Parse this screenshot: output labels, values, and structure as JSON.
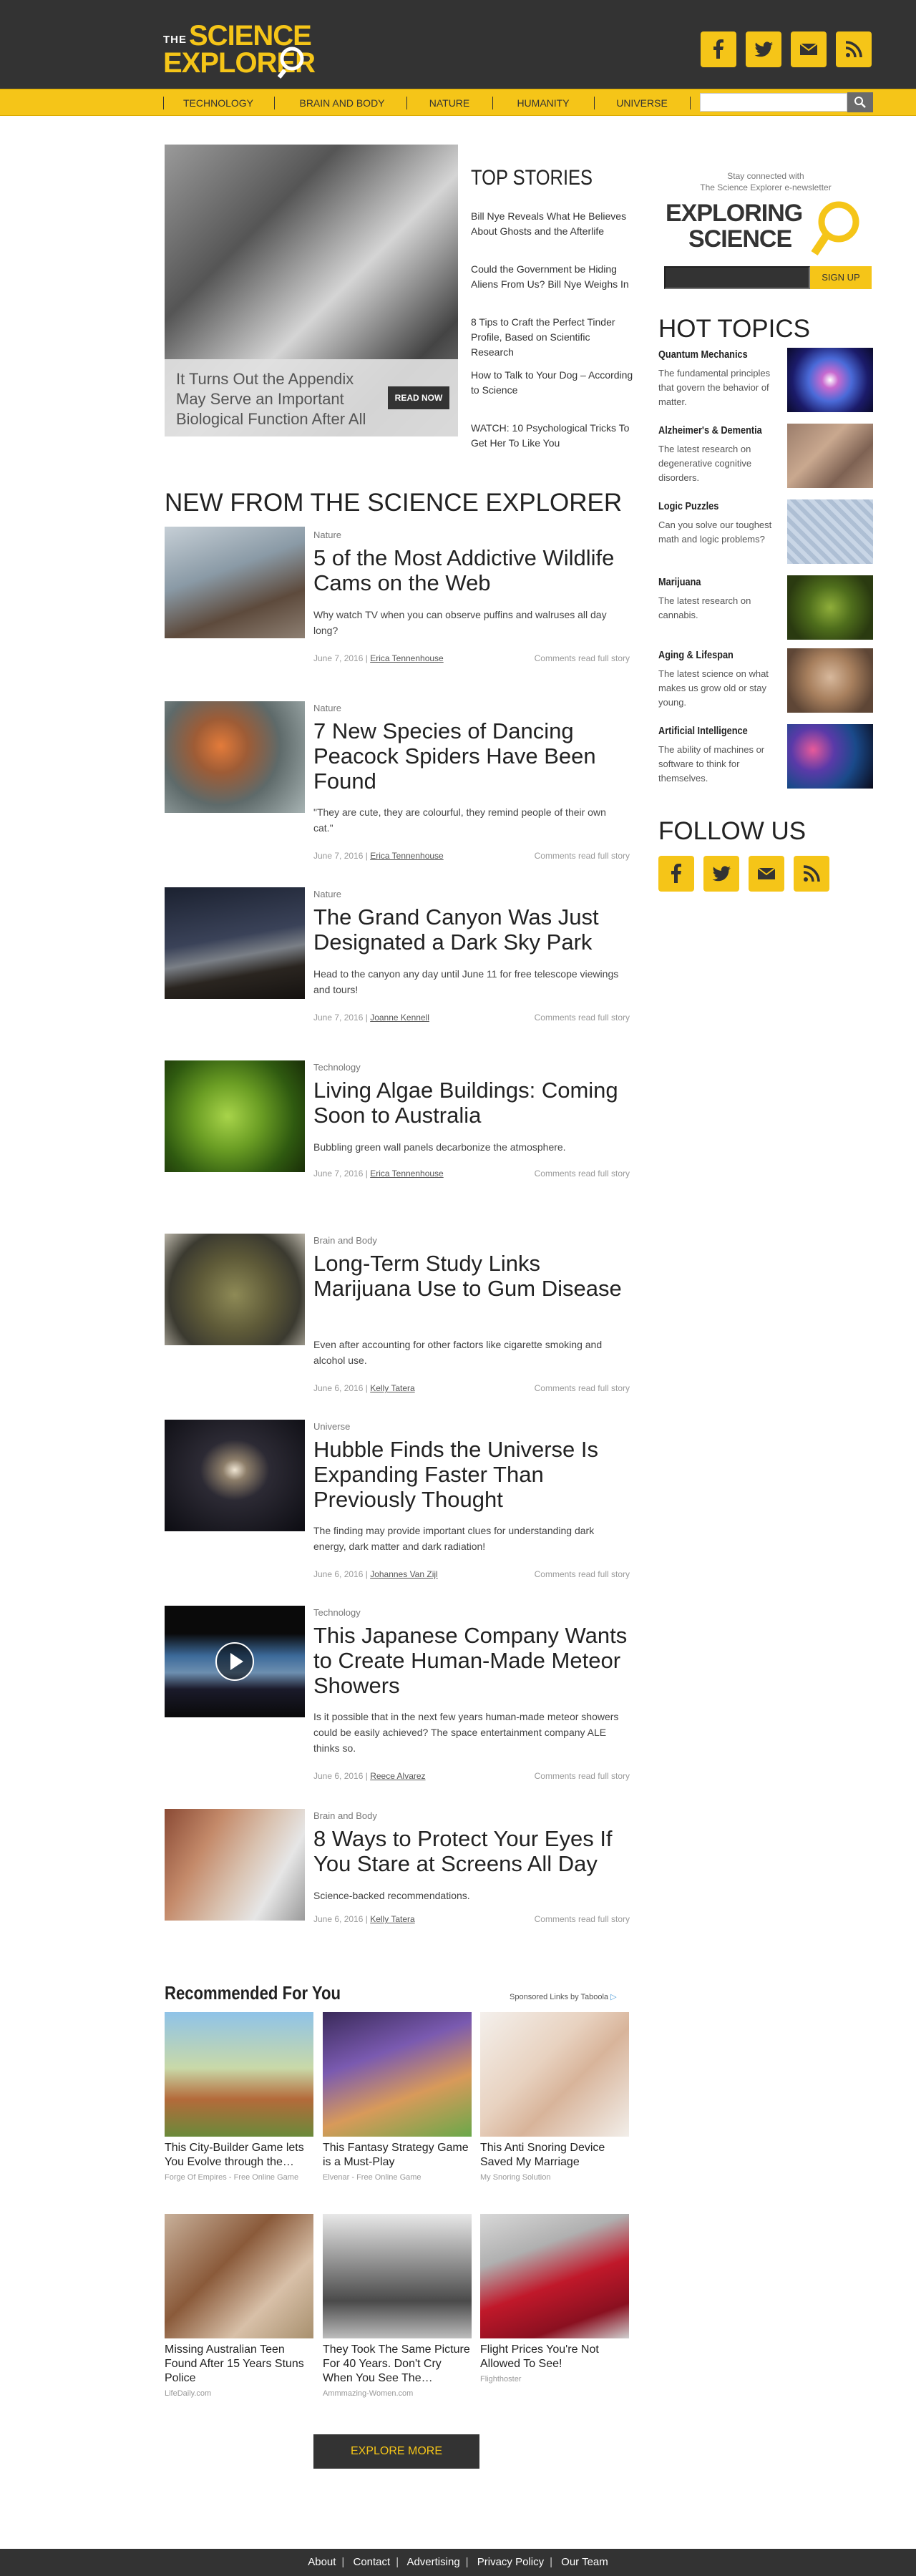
{
  "brand": {
    "the": "THE",
    "line1": "SCIENCE",
    "line2": "EXPLORER",
    "accent": "#f5c518",
    "dark": "#333333"
  },
  "header_social": [
    "facebook-icon",
    "twitter-icon",
    "mail-icon",
    "rss-icon"
  ],
  "nav": [
    "TECHNOLOGY",
    "BRAIN AND BODY",
    "NATURE",
    "HUMANITY",
    "UNIVERSE"
  ],
  "search": {
    "placeholder": ""
  },
  "hero": {
    "caption": "It Turns Out the Appendix May Serve an Important Biological Function After All",
    "button": "READ NOW"
  },
  "top_stories": {
    "title": "TOP STORIES",
    "items": [
      "Bill Nye Reveals What He Believes About Ghosts and the Afterlife",
      "Could the Government be Hiding Aliens From Us? Bill Nye Weighs In",
      "8 Tips to Craft the Perfect Tinder Profile, Based on Scientific Research",
      "How to Talk to Your Dog – According to Science",
      "WATCH: 10 Psychological Tricks To Get Her To Like You"
    ]
  },
  "section_title": "NEW FROM THE SCIENCE EXPLORER",
  "articles": [
    {
      "cat": "Nature",
      "title": "5 of the Most Addictive Wildlife Cams on the Web",
      "desc": "Why watch TV when you can observe puffins and walruses all day long?",
      "date": "June 7, 2016 | ",
      "author": "Erica Tennenhouse",
      "links": "Comments    read full story"
    },
    {
      "cat": "Nature",
      "title": "7 New Species of Dancing Peacock Spiders Have Been Found",
      "desc": "\"They are cute, they are colourful, they remind people of their own cat.\"",
      "date": "June 7, 2016 | ",
      "author": "Erica Tennenhouse",
      "links": "Comments    read full story"
    },
    {
      "cat": "Nature",
      "title": "The Grand Canyon Was Just Designated a Dark Sky Park",
      "desc": "Head to the canyon any day until June 11 for free telescope viewings and tours!",
      "date": "June 7, 2016 | ",
      "author": "Joanne Kennell",
      "links": "Comments    read full story"
    },
    {
      "cat": "Technology",
      "title": "Living Algae Buildings: Coming Soon to Australia",
      "desc": "Bubbling green wall panels decarbonize the atmosphere.",
      "date": "June 7, 2016 | ",
      "author": "Erica Tennenhouse",
      "links": "Comments    read full story"
    },
    {
      "cat": "Brain and Body",
      "title": "Long-Term Study Links Marijuana Use to Gum Disease",
      "desc": "Even after accounting for other factors like cigarette smoking and alcohol use.",
      "date": "June 6, 2016 | ",
      "author": "Kelly Tatera",
      "links": "Comments    read full story"
    },
    {
      "cat": "Universe",
      "title": "Hubble Finds the Universe Is Expanding Faster Than Previously Thought",
      "desc": "The finding may provide important clues for understanding dark energy, dark matter and dark radiation!",
      "date": "June 6, 2016 | ",
      "author": "Johannes Van Zijl",
      "links": "Comments    read full story"
    },
    {
      "cat": "Technology",
      "title": "This Japanese Company Wants to Create Human-Made Meteor Showers",
      "desc": "Is it possible that in the next few years human-made meteor showers could be easily achieved? The space entertainment company ALE thinks so.",
      "date": "June 6, 2016 | ",
      "author": "Reece Alvarez",
      "links": "Comments    read full story"
    },
    {
      "cat": "Brain and Body",
      "title": "8 Ways to Protect Your Eyes If You Stare at Screens All Day",
      "desc": "Science-backed recommendations.",
      "date": "June 6, 2016 | ",
      "author": "Kelly Tatera",
      "links": "Comments    read full story"
    }
  ],
  "newsletter": {
    "line1": "Stay connected with",
    "line2": "The Science Explorer e-newsletter",
    "logo1": "EXPLORING",
    "logo2": "SCIENCE",
    "button": "SIGN UP"
  },
  "hot_topics": {
    "title": "HOT TOPICS",
    "items": [
      {
        "title": "Quantum Mechanics",
        "desc": "The fundamental principles that govern the behavior of matter."
      },
      {
        "title": "Alzheimer's & Dementia",
        "desc": "The latest research on degenerative cognitive disorders."
      },
      {
        "title": "Logic Puzzles",
        "desc": "Can you solve our toughest math and logic problems?"
      },
      {
        "title": "Marijuana",
        "desc": "The latest research on cannabis."
      },
      {
        "title": "Aging & Lifespan",
        "desc": "The latest science on what makes us grow old or stay young."
      },
      {
        "title": "Artificial Intelligence",
        "desc": "The ability of machines or software to think for themselves."
      }
    ]
  },
  "follow": {
    "title": "FOLLOW US"
  },
  "recommended": {
    "title": "Recommended For You",
    "sponsor": "Sponsored Links by Taboola",
    "items": [
      {
        "title": "This City-Builder Game lets You Evolve through the…",
        "source": "Forge Of Empires - Free Online Game"
      },
      {
        "title": "This Fantasy Strategy Game is a Must-Play",
        "source": "Elvenar - Free Online Game"
      },
      {
        "title": "This Anti Snoring Device Saved My Marriage",
        "source": "My Snoring Solution"
      },
      {
        "title": "Missing Australian Teen Found After 15 Years Stuns Police",
        "source": "LifeDaily.com"
      },
      {
        "title": "They Took The Same Picture For 40 Years. Don't Cry When You See The…",
        "source": "Ammmazing-Women.com"
      },
      {
        "title": "Flight Prices You're Not Allowed To See!",
        "source": "Flighthoster"
      }
    ]
  },
  "explore_more": "EXPLORE MORE",
  "footer": [
    "About",
    "Contact",
    "Advertising",
    "Privacy Policy",
    "Our Team"
  ]
}
